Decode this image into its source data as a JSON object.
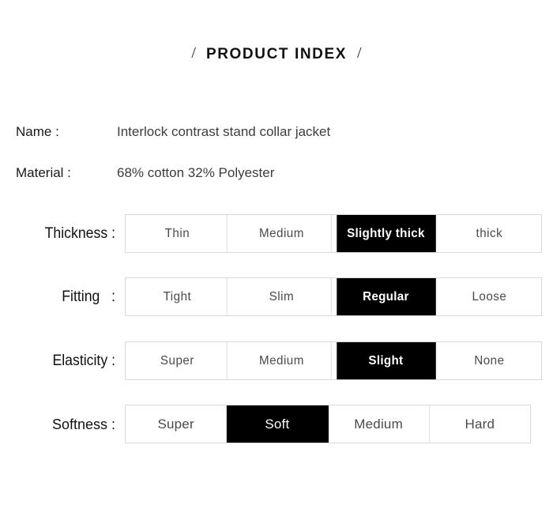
{
  "title": {
    "left_slash": "/",
    "text": "PRODUCT INDEX",
    "right_slash": "/"
  },
  "info": [
    {
      "label": "Name :",
      "value": "Interlock contrast stand collar jacket"
    },
    {
      "label": "Material :",
      "value": "68% cotton 32% Polyester"
    }
  ],
  "attributes": [
    {
      "label": "Thickness :",
      "options": [
        "Thin",
        "Medium",
        "Slightly thick",
        "thick"
      ],
      "selected_index": 2,
      "selected_value": "Slightly thick"
    },
    {
      "label": "Fitting   :",
      "options": [
        "Tight",
        "Slim",
        "Regular",
        "Loose"
      ],
      "selected_index": 2,
      "selected_value": "Regular"
    },
    {
      "label": "Elasticity :",
      "options": [
        "Super",
        "Medium",
        "Slight",
        "None"
      ],
      "selected_index": 2,
      "selected_value": "Slight"
    },
    {
      "label": "Softness :",
      "options": [
        "Super",
        "Soft",
        "Medium",
        "Hard"
      ],
      "selected_index": 1,
      "selected_value": "Soft"
    }
  ],
  "colors": {
    "background": "#ffffff",
    "text": "#1a1a1a",
    "value_text": "#3d3d3d",
    "border": "#d8d8d8",
    "selected_background": "#000000",
    "selected_text": "#ffffff"
  }
}
